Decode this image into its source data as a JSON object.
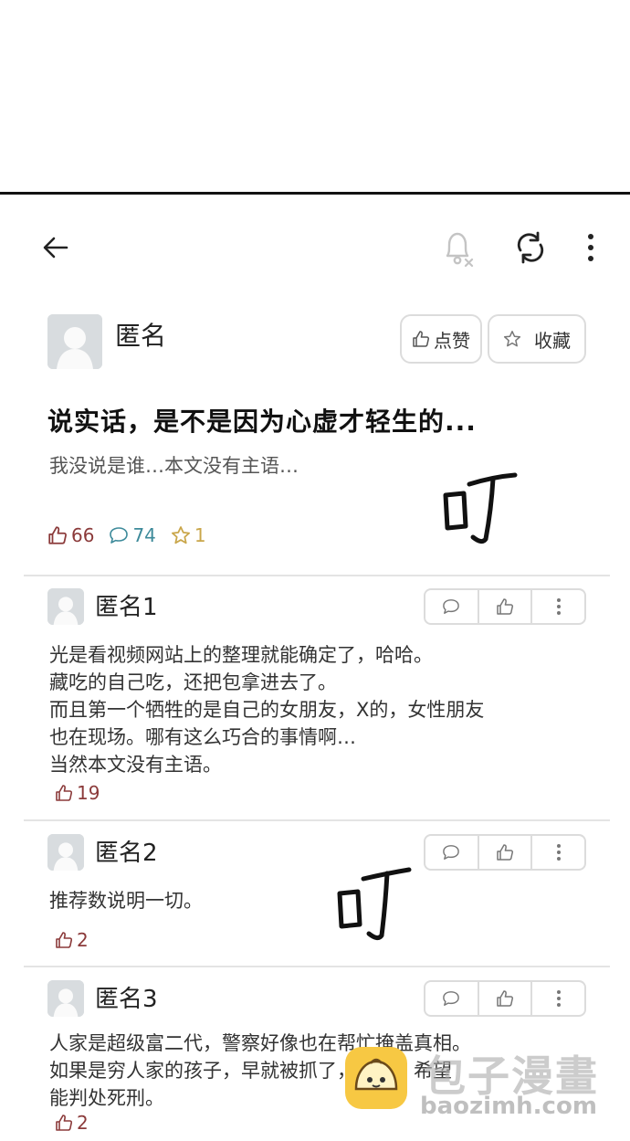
{
  "post": {
    "author": "匿名",
    "like_button": "点赞",
    "favorite_button": "收藏",
    "title": "说实话，是不是因为心虚才轻生的...",
    "body": "我没说是谁…本文没有主语…",
    "stats": {
      "likes": "66",
      "comments": "74",
      "favorites": "1"
    }
  },
  "sfx": [
    "叮",
    "叮"
  ],
  "comments": [
    {
      "author": "匿名1",
      "lines": [
        "光是看视频网站上的整理就能确定了，哈哈。",
        "藏吃的自己吃，还把包拿进去了。",
        "而且第一个牺牲的是自己的女朋友，X的，女性朋友",
        "也在现场。哪有这么巧合的事情啊…",
        "当然本文没有主语。"
      ],
      "likes": "19"
    },
    {
      "author": "匿名2",
      "lines": [
        "推荐数说明一切。"
      ],
      "likes": "2"
    },
    {
      "author": "匿名3",
      "lines": [
        "人家是超级富二代，警察好像也在帮忙掩盖真相。",
        "如果是穷人家的孩子，早就被抓了，哈哈。希望",
        "能判处死刑。"
      ],
      "likes": "2"
    }
  ],
  "watermark": {
    "title": "包子漫畫",
    "url": "baozimh.com"
  },
  "icons": [
    "back-arrow-icon",
    "bell-off-icon",
    "refresh-icon",
    "more-vertical-icon",
    "thumbs-up-icon",
    "star-icon",
    "comment-icon"
  ],
  "colors": {
    "like": "#8b3a3a",
    "comment": "#3d8a9a",
    "favorite": "#c9a64a",
    "divider": "#e4e4e4"
  }
}
